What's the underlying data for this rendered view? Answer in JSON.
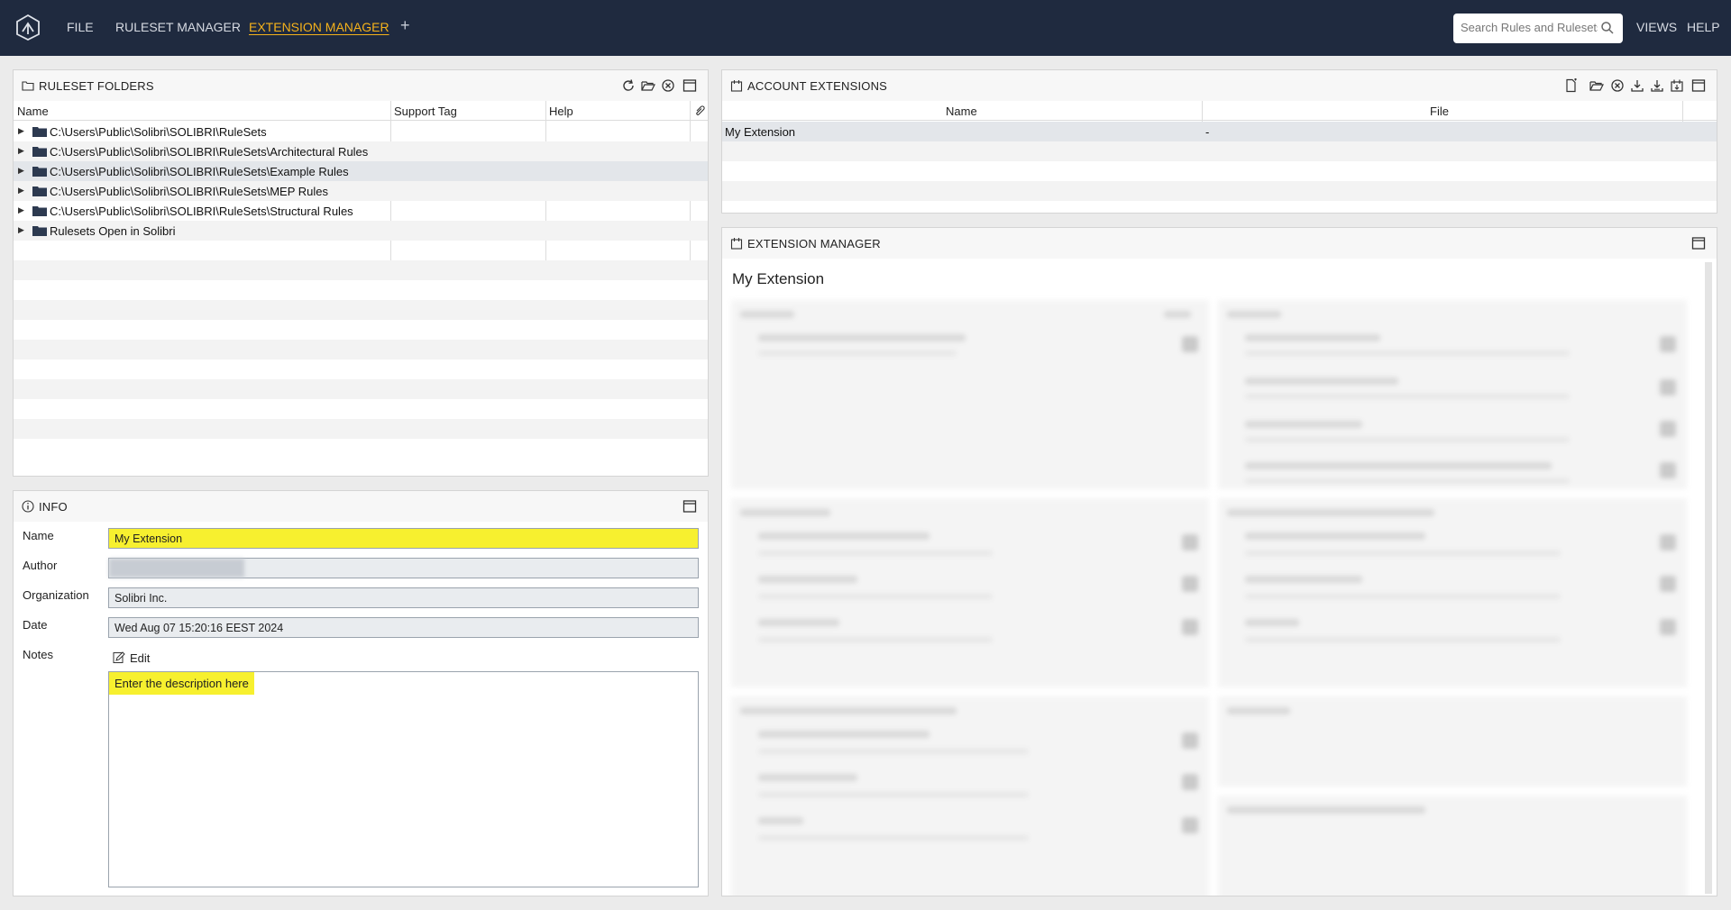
{
  "menu": {
    "file": "FILE",
    "ruleset_manager": "RULESET MANAGER",
    "extension_manager": "EXTENSION MANAGER",
    "plus": "+",
    "views": "VIEWS",
    "help": "HELP"
  },
  "search": {
    "placeholder": "Search Rules and Rulesets"
  },
  "ruleset_folders": {
    "title": "RULESET FOLDERS",
    "columns": [
      "Name",
      "Support Tag",
      "Help"
    ],
    "rows": [
      "C:\\Users\\Public\\Solibri\\SOLIBRI\\RuleSets",
      "C:\\Users\\Public\\Solibri\\SOLIBRI\\RuleSets\\Architectural Rules",
      "C:\\Users\\Public\\Solibri\\SOLIBRI\\RuleSets\\Example Rules",
      "C:\\Users\\Public\\Solibri\\SOLIBRI\\RuleSets\\MEP Rules",
      "C:\\Users\\Public\\Solibri\\SOLIBRI\\RuleSets\\Structural Rules",
      "Rulesets Open in Solibri"
    ]
  },
  "info": {
    "title": "INFO",
    "labels": {
      "name": "Name",
      "author": "Author",
      "organization": "Organization",
      "date": "Date",
      "notes": "Notes"
    },
    "values": {
      "name": "My Extension",
      "author": "",
      "organization": "Solibri Inc.",
      "date": "Wed Aug 07 15:20:16 EEST 2024"
    },
    "edit_label": "Edit",
    "notes_text": "Enter the description here"
  },
  "account_extensions": {
    "title": "ACCOUNT EXTENSIONS",
    "columns": [
      "Name",
      "File"
    ],
    "rows": [
      {
        "name": "My Extension",
        "file": "-"
      }
    ]
  },
  "extension_manager": {
    "title": "EXTENSION MANAGER",
    "heading": "My Extension"
  },
  "colors": {
    "topbar": "#1f2a3f",
    "active_menu": "#f5b21b",
    "highlight": "#f7f02f"
  }
}
